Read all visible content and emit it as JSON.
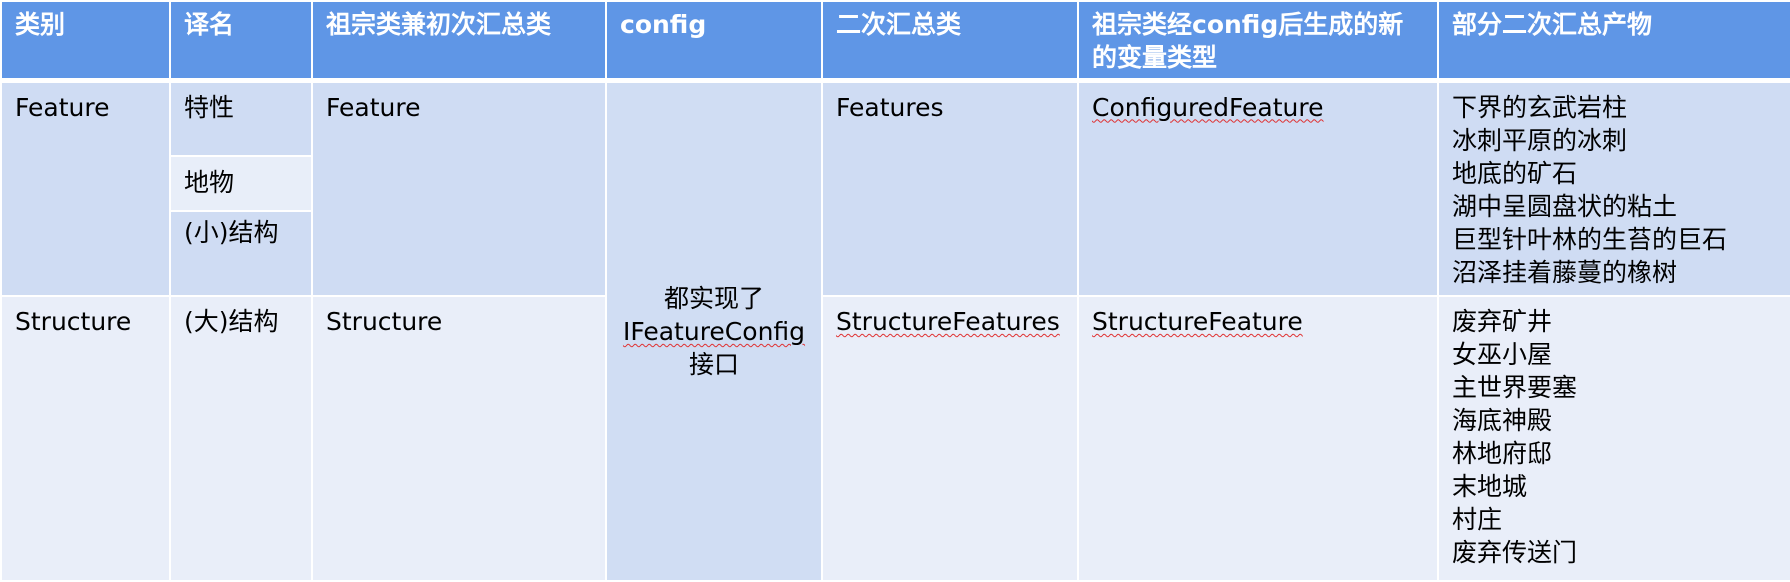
{
  "headers": {
    "category": "类别",
    "translation": "译名",
    "ancestor": "祖宗类兼初次汇总类",
    "config": "config",
    "secondary": "二次汇总类",
    "new_type": "祖宗类经config后生成的新的变量类型",
    "products": "部分二次汇总产物"
  },
  "feature_row": {
    "category": "Feature",
    "translations": [
      "特性",
      "地物",
      "(小)结构"
    ],
    "ancestor": "Feature",
    "secondary": "Features",
    "new_type": "ConfiguredFeature",
    "products": [
      "下界的玄武岩柱",
      "冰刺平原的冰刺",
      "地底的矿石",
      "湖中呈圆盘状的粘土",
      "巨型针叶林的生苔的巨石",
      "沼泽挂着藤蔓的橡树"
    ]
  },
  "structure_row": {
    "category": "Structure",
    "translation": "(大)结构",
    "ancestor": "Structure",
    "secondary": "StructureFeatures",
    "new_type": "StructureFeature",
    "products": [
      "废弃矿井",
      "女巫小屋",
      "主世界要塞",
      "海底神殿",
      "林地府邸",
      "末地城",
      "村庄",
      "废弃传送门"
    ]
  },
  "config_cell": {
    "line1": "都实现了",
    "line2": "IFeatureConfig",
    "line3": "接口"
  },
  "colors": {
    "header_bg": "#5f96e6",
    "feature_row_bg": "#cfdcf3",
    "structure_row_bg": "#e9eef9",
    "config_bg": "#d0ddf3",
    "spellcheck_underline": "#e03030"
  }
}
